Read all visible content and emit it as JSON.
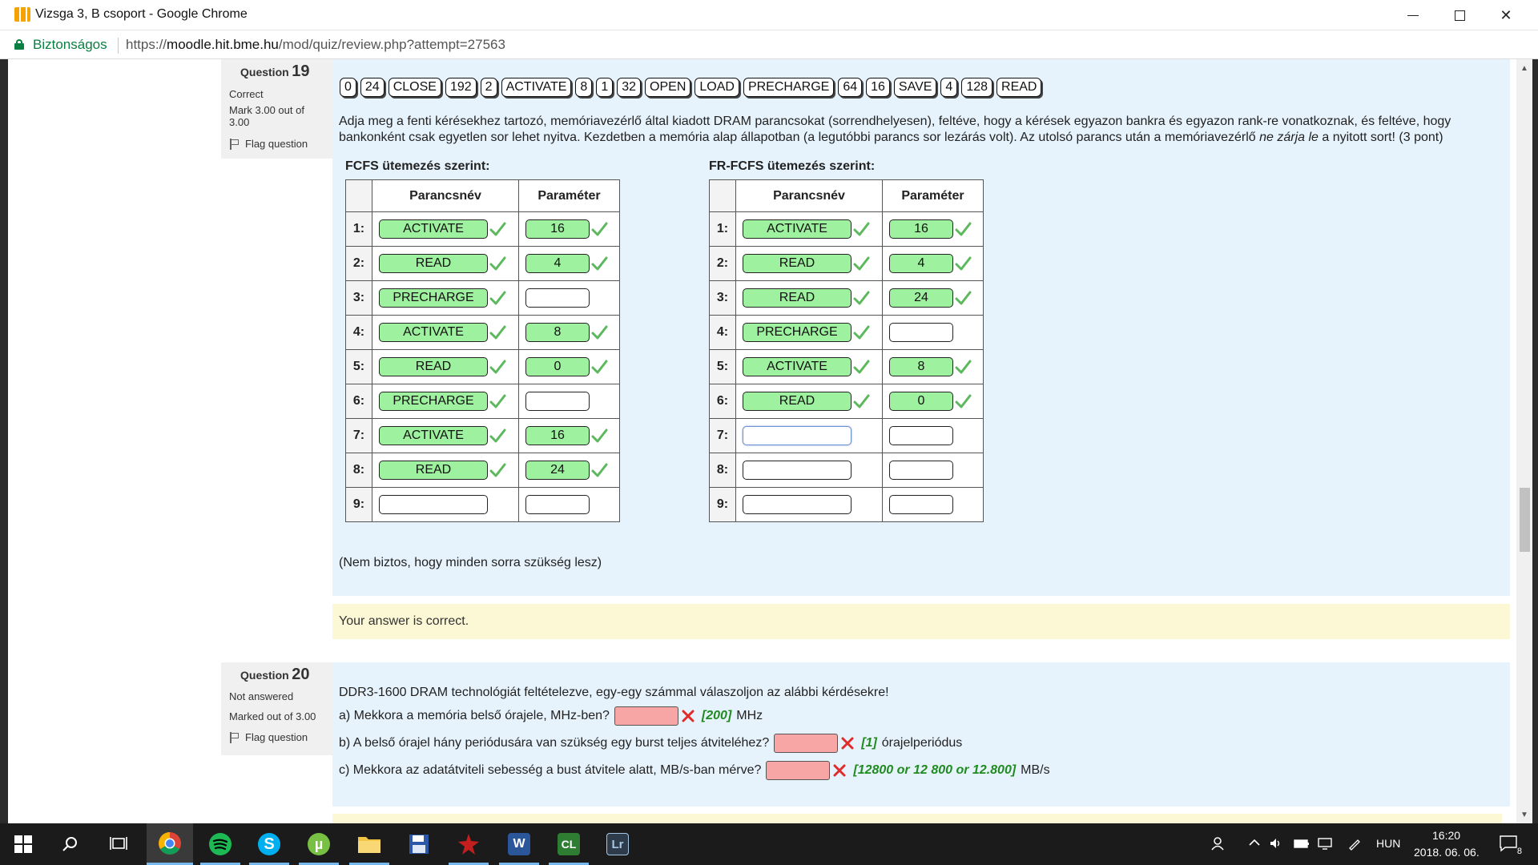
{
  "window": {
    "title": "Vizsga 3, B csoport - Google Chrome",
    "min_glyph": "",
    "close_glyph": "✕"
  },
  "addressbar": {
    "secure_label": "Biztonságos",
    "url_scheme": "https://",
    "url_host": "moodle.hit.bme.hu",
    "url_path": "/mod/quiz/review.php?attempt=27563"
  },
  "q19": {
    "label": "Question",
    "number": "19",
    "state": "Correct",
    "grade": "Mark 3.00 out of 3.00",
    "flag": "Flag question",
    "drag_items": [
      "0",
      "24",
      "CLOSE",
      "192",
      "2",
      "ACTIVATE",
      "8",
      "1",
      "32",
      "OPEN",
      "LOAD",
      "PRECHARGE",
      "64",
      "16",
      "SAVE",
      "4",
      "128",
      "READ"
    ],
    "text_part1": "Adja meg a fenti kérésekhez tartozó, memóriavezérlő által kiadott DRAM parancsokat (sorrendhelyesen), feltéve, hogy a kérések egyazon bankra és egyazon rank-re vonatkoznak, és feltéve, hogy bankonként csak egyetlen sor lehet nyitva. Kezdetben a memória alap állapotban (a legutóbbi parancs sor lezárás volt). Az utolsó parancs után a memóriavezérlő ",
    "text_italic": "ne zárja le",
    "text_part2": " a nyitott sort! (3 pont)",
    "fcfs_title": "FCFS ütemezés szerint:",
    "frfcfs_title": "FR-FCFS ütemezés szerint:",
    "col_cmd": "Parancsnév",
    "col_param": "Paraméter",
    "fcfs_rows": [
      {
        "n": "1:",
        "cmd": "ACTIVATE",
        "param": "16"
      },
      {
        "n": "2:",
        "cmd": "READ",
        "param": "4"
      },
      {
        "n": "3:",
        "cmd": "PRECHARGE",
        "param": ""
      },
      {
        "n": "4:",
        "cmd": "ACTIVATE",
        "param": "8"
      },
      {
        "n": "5:",
        "cmd": "READ",
        "param": "0"
      },
      {
        "n": "6:",
        "cmd": "PRECHARGE",
        "param": ""
      },
      {
        "n": "7:",
        "cmd": "ACTIVATE",
        "param": "16"
      },
      {
        "n": "8:",
        "cmd": "READ",
        "param": "24"
      },
      {
        "n": "9:",
        "cmd": "",
        "param": ""
      }
    ],
    "frfcfs_rows": [
      {
        "n": "1:",
        "cmd": "ACTIVATE",
        "param": "16"
      },
      {
        "n": "2:",
        "cmd": "READ",
        "param": "4"
      },
      {
        "n": "3:",
        "cmd": "READ",
        "param": "24"
      },
      {
        "n": "4:",
        "cmd": "PRECHARGE",
        "param": ""
      },
      {
        "n": "5:",
        "cmd": "ACTIVATE",
        "param": "8"
      },
      {
        "n": "6:",
        "cmd": "READ",
        "param": "0"
      },
      {
        "n": "7:",
        "cmd": "",
        "param": ""
      },
      {
        "n": "8:",
        "cmd": "",
        "param": ""
      },
      {
        "n": "9:",
        "cmd": "",
        "param": ""
      }
    ],
    "note": "(Nem biztos, hogy minden sorra szükség lesz)",
    "feedback": "Your answer is correct."
  },
  "q20": {
    "label": "Question",
    "number": "20",
    "state": "Not answered",
    "grade": "Marked out of 3.00",
    "flag": "Flag question",
    "intro": "DDR3-1600 DRAM technológiát feltételezve, egy-egy számmal válaszoljon az alábbi kérdésekre!",
    "a_text": "a) Mekkora a memória belső órajele, MHz-ben?",
    "a_answer": "[200]",
    "a_unit": "MHz",
    "b_text": "b) A belső órajel hány periódusára van szükség egy burst teljes átviteléhez?",
    "b_answer": "[1]",
    "b_unit": "órajelperiódus",
    "c_text": "c) Mekkora az adatátviteli sebesség a bust átvitele alatt, MB/s-ban mérve?",
    "c_answer": "[12800 or 12 800 or 12.800]",
    "c_unit": "MB/s"
  },
  "taskbar": {
    "lang": "HUN",
    "time": "16:20",
    "date": "2018. 06. 06.",
    "notifications": "8",
    "apps": [
      "start",
      "search",
      "task-view",
      "chrome",
      "spotify",
      "skype",
      "utorrent",
      "file-explorer",
      "save",
      "game",
      "word",
      "cl",
      "lightroom"
    ],
    "skype_glyph": "S",
    "utorrent_glyph": "µ",
    "word_glyph": "W",
    "cl_glyph": "CL",
    "lightroom_glyph": "Lr"
  },
  "colors": {
    "correct_green": "#9ef19e",
    "wrong_red": "#f7a5a5",
    "content_blue": "#e7f3fc",
    "feedback_yellow": "#fcf7d4",
    "right_answer_green": "#218b21"
  }
}
